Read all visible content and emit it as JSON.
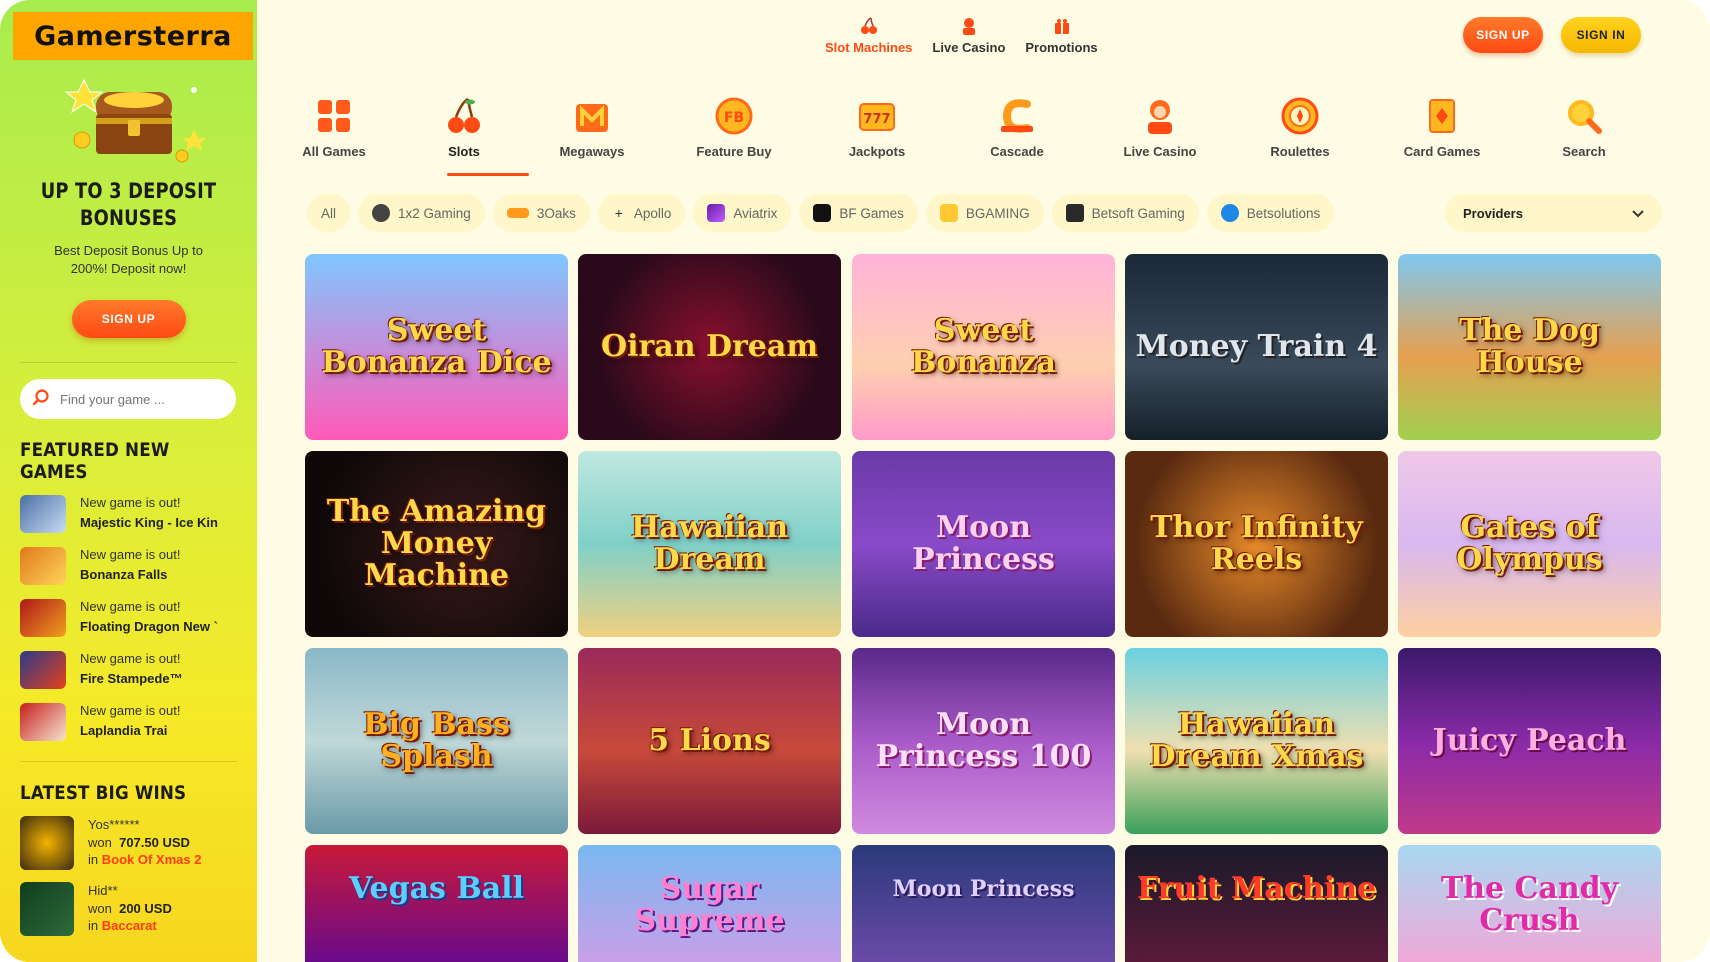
{
  "brand": {
    "logo": "Gamersterra"
  },
  "sidebar": {
    "promo_title": "UP TO 3 DEPOSIT BONUSES",
    "promo_sub": "Best Deposit Bonus Up to 200%! Deposit now!",
    "signup_label": "SIGN UP",
    "search_placeholder": "Find your game ...",
    "featured_title": "FEATURED NEW GAMES",
    "featured": [
      {
        "line1": "New game is out!",
        "name": "Majestic King - Ice Kin"
      },
      {
        "line1": "New game is out!",
        "name": "Bonanza Falls"
      },
      {
        "line1": "New game is out!",
        "name": "Floating Dragon New `"
      },
      {
        "line1": "New game is out!",
        "name": "Fire Stampede™"
      },
      {
        "line1": "New game is out!",
        "name": "Laplandia Trai"
      }
    ],
    "wins_title": "LATEST BIG WINS",
    "wins": [
      {
        "user": "Yos******",
        "won_label": "won",
        "amount": "707.50 USD",
        "in_label": "in",
        "game": "Book Of Xmas 2"
      },
      {
        "user": "Hid**",
        "won_label": "won",
        "amount": "200 USD",
        "in_label": "in",
        "game": "Baccarat"
      }
    ]
  },
  "topnav": [
    {
      "label": "Slot Machines",
      "icon": "cherry-icon",
      "active": true
    },
    {
      "label": "Live Casino",
      "icon": "dealer-icon"
    },
    {
      "label": "Promotions",
      "icon": "gift-icon"
    }
  ],
  "auth": {
    "signup": "SIGN UP",
    "signin": "SIGN IN"
  },
  "categories": [
    {
      "label": "All Games",
      "icon": "grid-icon"
    },
    {
      "label": "Slots",
      "icon": "cherry-icon"
    },
    {
      "label": "Megaways",
      "icon": "megaways-icon"
    },
    {
      "label": "Feature Buy",
      "icon": "fb-coin-icon"
    },
    {
      "label": "Jackpots",
      "icon": "jackpot-777-icon"
    },
    {
      "label": "Cascade",
      "icon": "cascade-icon"
    },
    {
      "label": "Live Casino",
      "icon": "dealer-icon"
    },
    {
      "label": "Roulettes",
      "icon": "roulette-icon"
    },
    {
      "label": "Card Games",
      "icon": "card-icon"
    },
    {
      "label": "Search",
      "icon": "magnifier-icon"
    }
  ],
  "providers": {
    "chips": [
      "All",
      "1x2 Gaming",
      "3Oaks",
      "Apollo",
      "Aviatrix",
      "BF Games",
      "BGAMING",
      "Betsoft Gaming",
      "Betsolutions"
    ],
    "select_label": "Providers"
  },
  "games": [
    "Sweet Bonanza Dice",
    "Oiran Dream",
    "Sweet Bonanza",
    "Money Train 4",
    "The Dog House",
    "The Amazing Money Machine",
    "Hawaiian Dream",
    "Moon Princess",
    "Thor Infinity Reels",
    "Gates of Olympus",
    "Big Bass Splash",
    "5 Lions",
    "Moon Princess 100",
    "Hawaiian Dream Xmas",
    "Juicy Peach",
    "Vegas Ball",
    "Sugar Supreme",
    "Moon Princess",
    "Fruit Machine",
    "The Candy Crush"
  ],
  "colors": {
    "accent": "#ff4a14",
    "gold": "#f5b800",
    "sidebar_top": "#a8ec4e",
    "background": "#fffce6"
  }
}
